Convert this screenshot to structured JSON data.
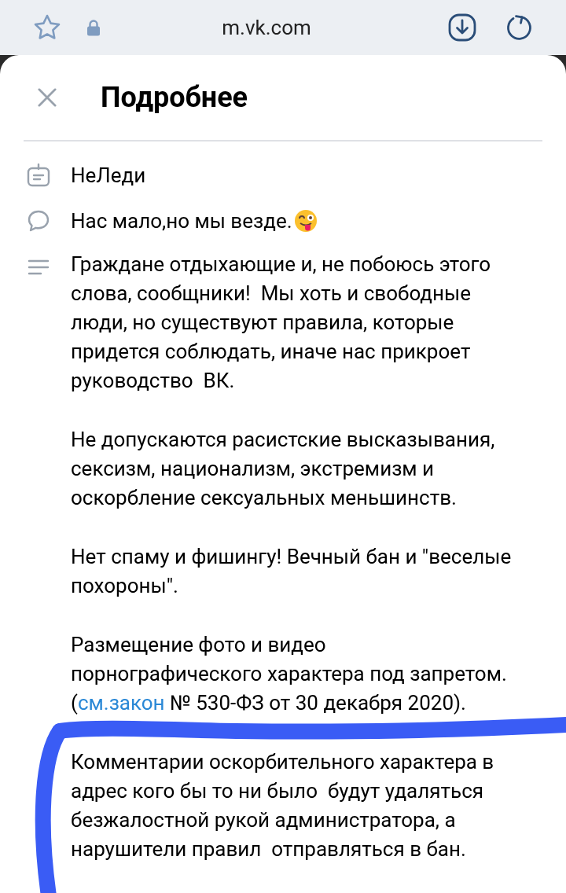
{
  "browser": {
    "url": "m.vk.com"
  },
  "sheet": {
    "title": "Подробнее"
  },
  "info": [
    {
      "kind": "name",
      "text": "НеЛеди"
    },
    {
      "kind": "status",
      "text": "Нас мало,но мы везде.",
      "emoji": true
    }
  ],
  "description": [
    {
      "text": "Граждане отдыхающие и, не побоюсь этого слова, сообщники!  Мы хоть и свободные люди, но существуют правила, которые придется соблюдать, иначе нас прикроет руководство  ВК."
    },
    {
      "text": "Не допускаются расистские высказывания, сексизм, национализм, экстремизм и оскорбление сексуальных меньшинств."
    },
    {
      "text": "Нет спаму и фишингу! Вечный бан и \"веселые похороны\"."
    },
    {
      "text": "Размещение фото и видео порнографического характера под запретом.",
      "prefix": "(",
      "link": "см.закон",
      "suffix": " № 530-ФЗ от 30 декабря 2020)."
    },
    {
      "text": "Комментарии оскорбительного характера в адрес кого бы то ни было  будут удаляться безжалостной рукой администратора, а нарушители правил  отправляться в бан."
    }
  ]
}
